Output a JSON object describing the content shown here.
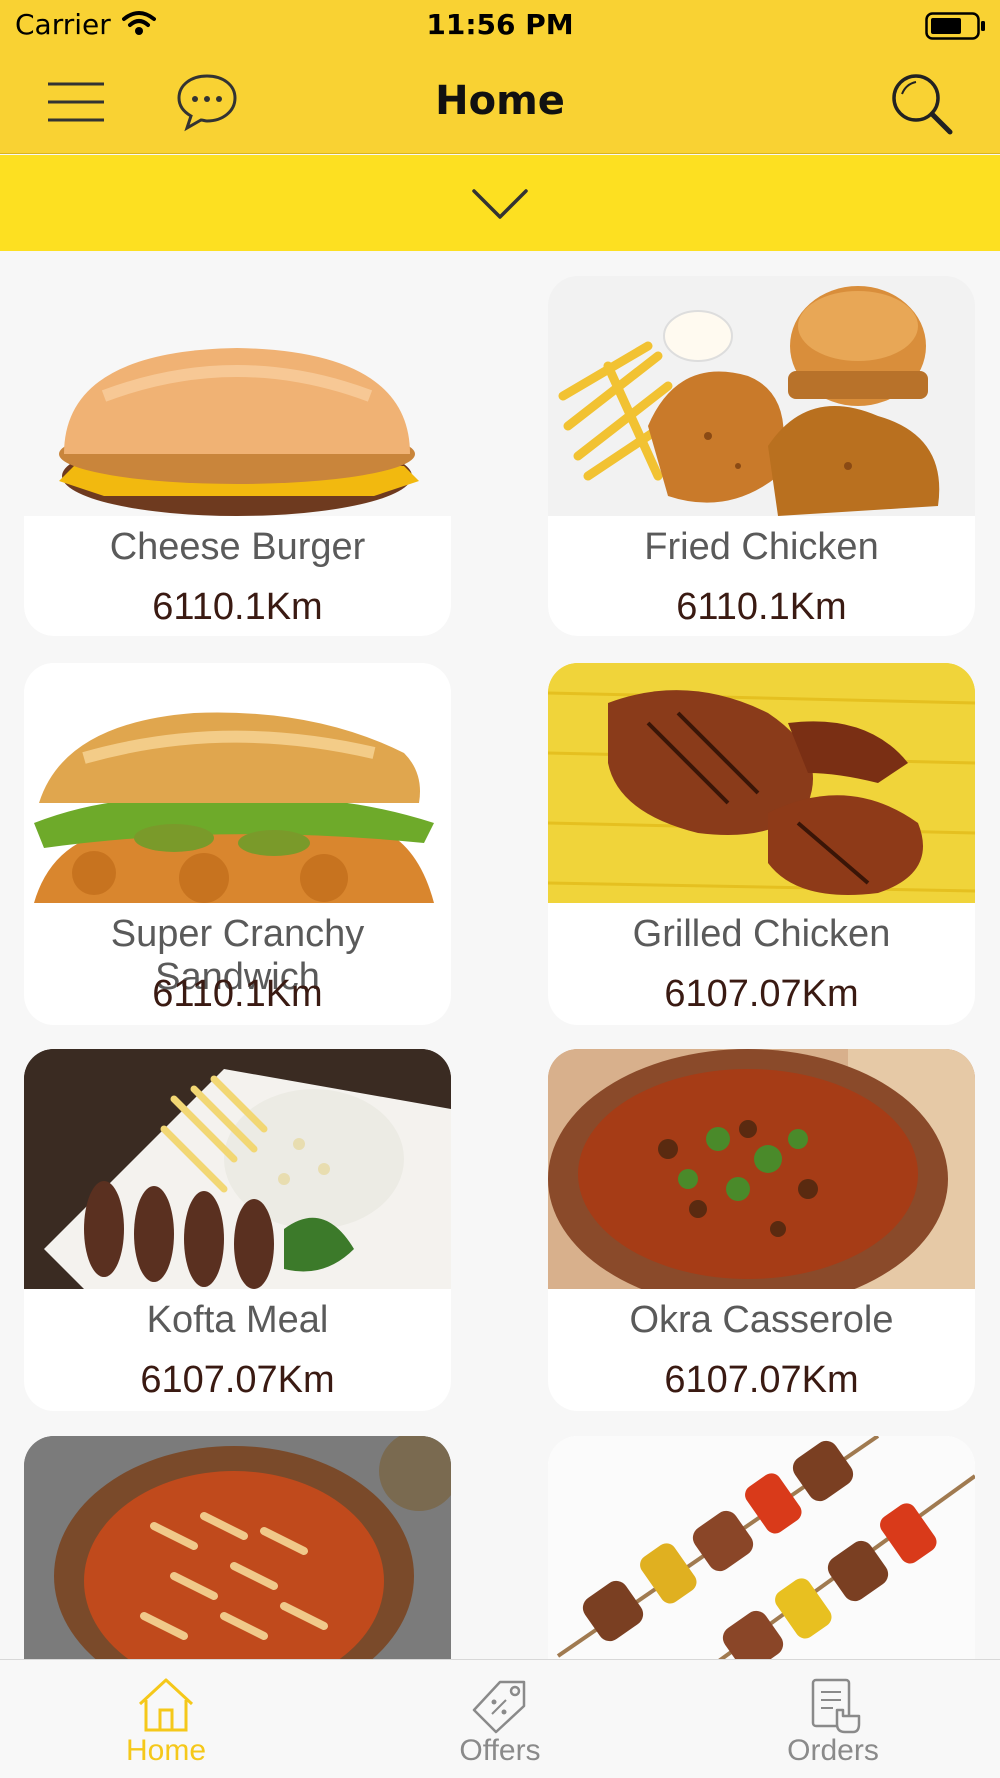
{
  "status": {
    "carrier": "Carrier",
    "time": "11:56 PM"
  },
  "nav": {
    "title": "Home"
  },
  "items": [
    {
      "name": "Cheese Burger",
      "distance": "6110.1Km"
    },
    {
      "name": "Fried Chicken",
      "distance": "6110.1Km"
    },
    {
      "name": "Super Cranchy Sandwich",
      "distance": "6110.1Km"
    },
    {
      "name": "Grilled Chicken",
      "distance": "6107.07Km"
    },
    {
      "name": "Kofta Meal",
      "distance": "6107.07Km"
    },
    {
      "name": "Okra Casserole",
      "distance": "6107.07Km"
    },
    {
      "name": "",
      "distance": ""
    },
    {
      "name": "",
      "distance": ""
    }
  ],
  "tabs": [
    {
      "label": "Home",
      "icon": "home-icon"
    },
    {
      "label": "Offers",
      "icon": "tag-icon"
    },
    {
      "label": "Orders",
      "icon": "orders-icon"
    }
  ],
  "colors": {
    "bar": "#f9d233",
    "filter_bar": "#fde021",
    "active_tab": "#f5c81a",
    "inactive_tab": "#8a8a8a"
  }
}
